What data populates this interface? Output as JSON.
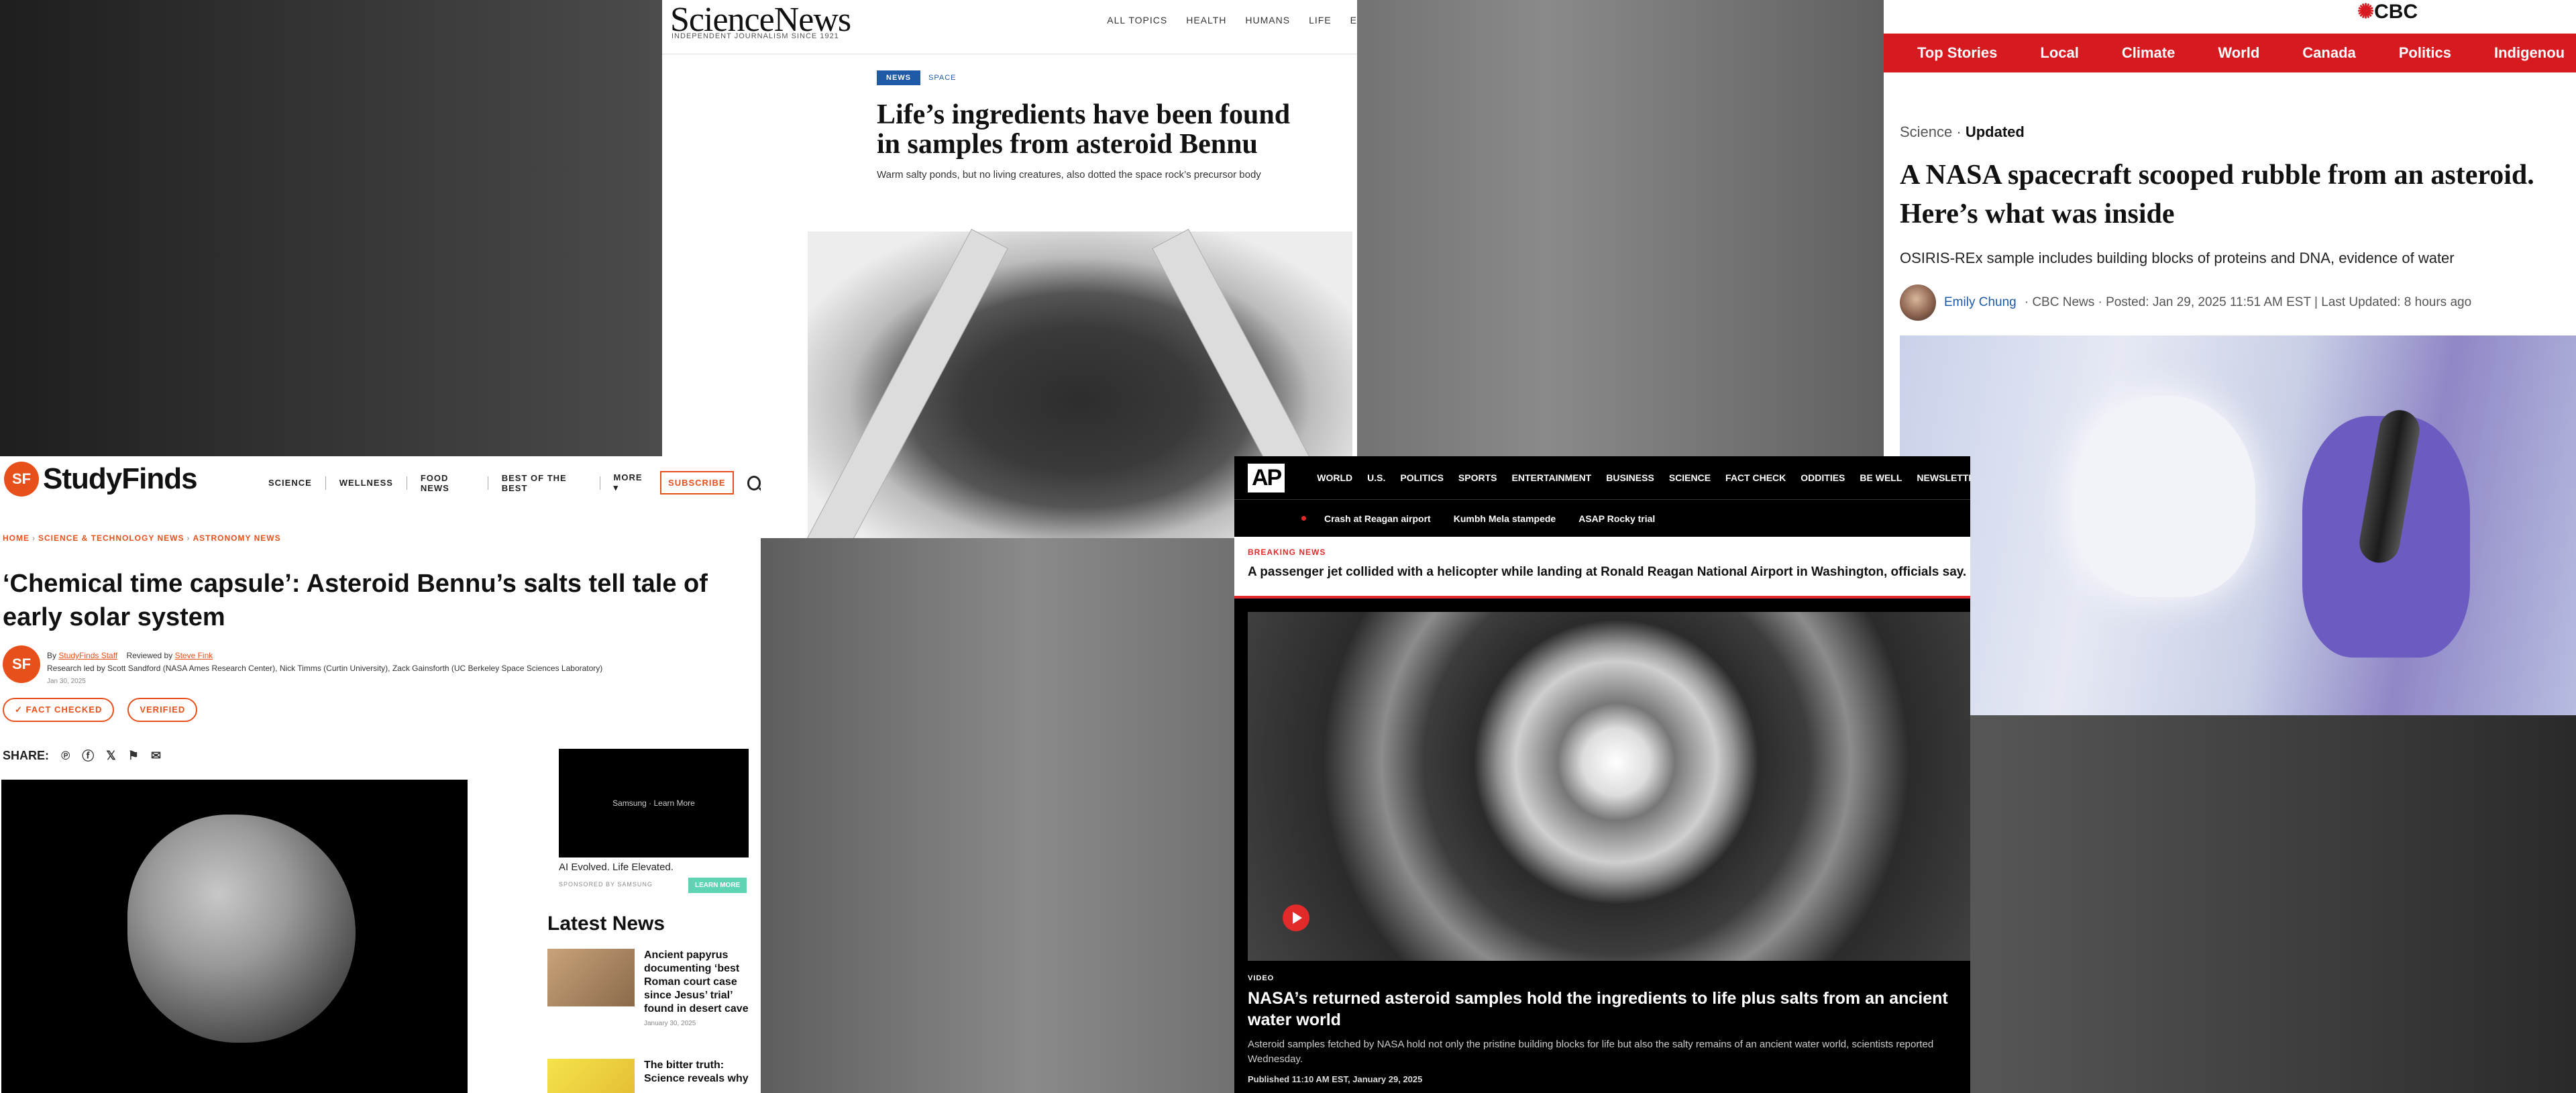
{
  "sciencenews": {
    "logo": "ScienceNews",
    "tagline": "INDEPENDENT JOURNALISM SINCE 1921",
    "nav": [
      "ALL TOPICS",
      "HEALTH",
      "HUMANS",
      "LIFE",
      "E"
    ],
    "badge_news": "NEWS",
    "badge_section": "SPACE",
    "headline": "Life’s ingredients have been found in samples from asteroid Bennu",
    "dek": "Warm salty ponds, but no living creatures, also dotted the space rock’s precursor body"
  },
  "cbc": {
    "logo": "CBC",
    "nav": [
      "Top Stories",
      "Local",
      "Climate",
      "World",
      "Canada",
      "Politics",
      "Indigenou"
    ],
    "section": "Science",
    "status": "Updated",
    "headline": "A NASA spacecraft scooped rubble from an asteroid. Here’s what was inside",
    "subhead": "OSIRIS-REx sample includes building blocks of proteins and DNA, evidence of water",
    "author": "Emily Chung",
    "byline_meta": "· CBC News · Posted: Jan 29, 2025 11:51 AM EST | Last Updated: 8 hours ago"
  },
  "studyfinds": {
    "logo": "StudyFinds",
    "logo_mark": "SF",
    "nav": [
      "SCIENCE",
      "WELLNESS",
      "FOOD NEWS",
      "BEST OF THE BEST",
      "MORE ▾"
    ],
    "subscribe": "SUBSCRIBE",
    "breadcrumbs": [
      "HOME",
      "SCIENCE & TECHNOLOGY NEWS",
      "ASTRONOMY NEWS"
    ],
    "headline": "‘Chemical time capsule’: Asteroid Bennu’s salts tell tale of early solar system",
    "by_prefix": "By",
    "by_author": "StudyFinds Staff",
    "reviewed_prefix": "Reviewed by",
    "reviewer": "Steve Fink",
    "research_credit": "Research led by Scott Sandford (NASA Ames Research Center), Nick Timms (Curtin University), Zack Gainsforth (UC Berkeley Space Sciences Laboratory)",
    "date": "Jan 30, 2025",
    "pill_fact": "✓ FACT CHECKED",
    "pill_verified": "VERIFIED",
    "share_label": "SHARE:",
    "ad_text": "Samsung · Learn More",
    "ad_caption": "AI Evolved. Life Elevated.",
    "ad_sponsor": "SPONSORED BY SAMSUNG",
    "ad_button": "LEARN MORE",
    "latest_title": "Latest News",
    "latest": [
      {
        "title": "Ancient papyrus documenting ‘best Roman court case since Jesus’ trial’ found in desert cave",
        "date": "January 30, 2025"
      },
      {
        "title": "The bitter truth: Science reveals why",
        "date": ""
      }
    ]
  },
  "ap": {
    "logo": "AP",
    "nav": [
      "WORLD",
      "U.S.",
      "POLITICS",
      "SPORTS",
      "ENTERTAINMENT",
      "BUSINESS",
      "SCIENCE",
      "FACT CHECK",
      "ODDITIES",
      "BE WELL",
      "NEWSLETTE"
    ],
    "trending": [
      "Crash at Reagan airport",
      "Kumbh Mela stampede",
      "ASAP Rocky trial"
    ],
    "breaking_label": "BREAKING NEWS",
    "breaking_text": "A passenger jet collided with a helicopter while landing at Ronald Reagan National Airport in Washington, officials say. Search",
    "video_label": "VIDEO",
    "headline": "NASA’s returned asteroid samples hold the ingredients to life plus salts from an ancient water world",
    "description": "Asteroid samples fetched by NASA hold not only the pristine building blocks for life but also the salty remains of an ancient water world, scientists reported Wednesday.",
    "published": "Published 11:10 AM EST, January 29, 2025"
  }
}
